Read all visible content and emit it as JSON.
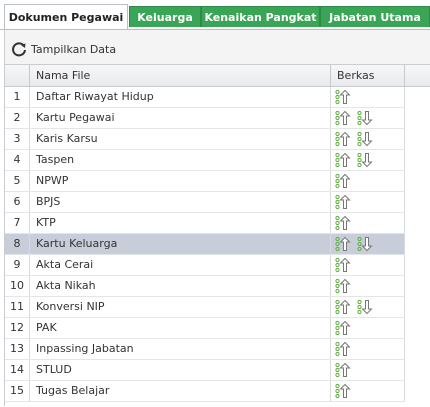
{
  "tabs": [
    {
      "label": "Dokumen Pegawai",
      "active": true
    },
    {
      "label": "Keluarga",
      "active": false
    },
    {
      "label": "Kenaikan Pangkat",
      "active": false
    },
    {
      "label": "Jabatan Utama",
      "active": false
    }
  ],
  "toolbar": {
    "refresh_label": "Tampilkan Data",
    "refresh_icon": "refresh-icon"
  },
  "grid": {
    "headers": {
      "num": "",
      "name": "Nama File",
      "berkas": "Berkas"
    },
    "rows": [
      {
        "num": "1",
        "name": "Daftar Riwayat Hidup",
        "download": false,
        "selected": false
      },
      {
        "num": "2",
        "name": "Kartu Pegawai",
        "download": true,
        "selected": false
      },
      {
        "num": "3",
        "name": "Karis Karsu",
        "download": true,
        "selected": false
      },
      {
        "num": "4",
        "name": "Taspen",
        "download": true,
        "selected": false
      },
      {
        "num": "5",
        "name": "NPWP",
        "download": false,
        "selected": false
      },
      {
        "num": "6",
        "name": "BPJS",
        "download": false,
        "selected": false
      },
      {
        "num": "7",
        "name": "KTP",
        "download": false,
        "selected": false
      },
      {
        "num": "8",
        "name": "Kartu Keluarga",
        "download": true,
        "selected": true
      },
      {
        "num": "9",
        "name": "Akta Cerai",
        "download": false,
        "selected": false
      },
      {
        "num": "10",
        "name": "Akta Nikah",
        "download": false,
        "selected": false
      },
      {
        "num": "11",
        "name": "Konversi NIP",
        "download": true,
        "selected": false
      },
      {
        "num": "12",
        "name": "PAK",
        "download": false,
        "selected": false
      },
      {
        "num": "13",
        "name": "Inpassing Jabatan",
        "download": false,
        "selected": false
      },
      {
        "num": "14",
        "name": "STLUD",
        "download": false,
        "selected": false
      },
      {
        "num": "15",
        "name": "Tugas Belajar",
        "download": false,
        "selected": false
      }
    ]
  },
  "colors": {
    "tab_green": "#3aa457",
    "selected_row": "#c7ced9",
    "icon_green": "#5fae3f"
  }
}
